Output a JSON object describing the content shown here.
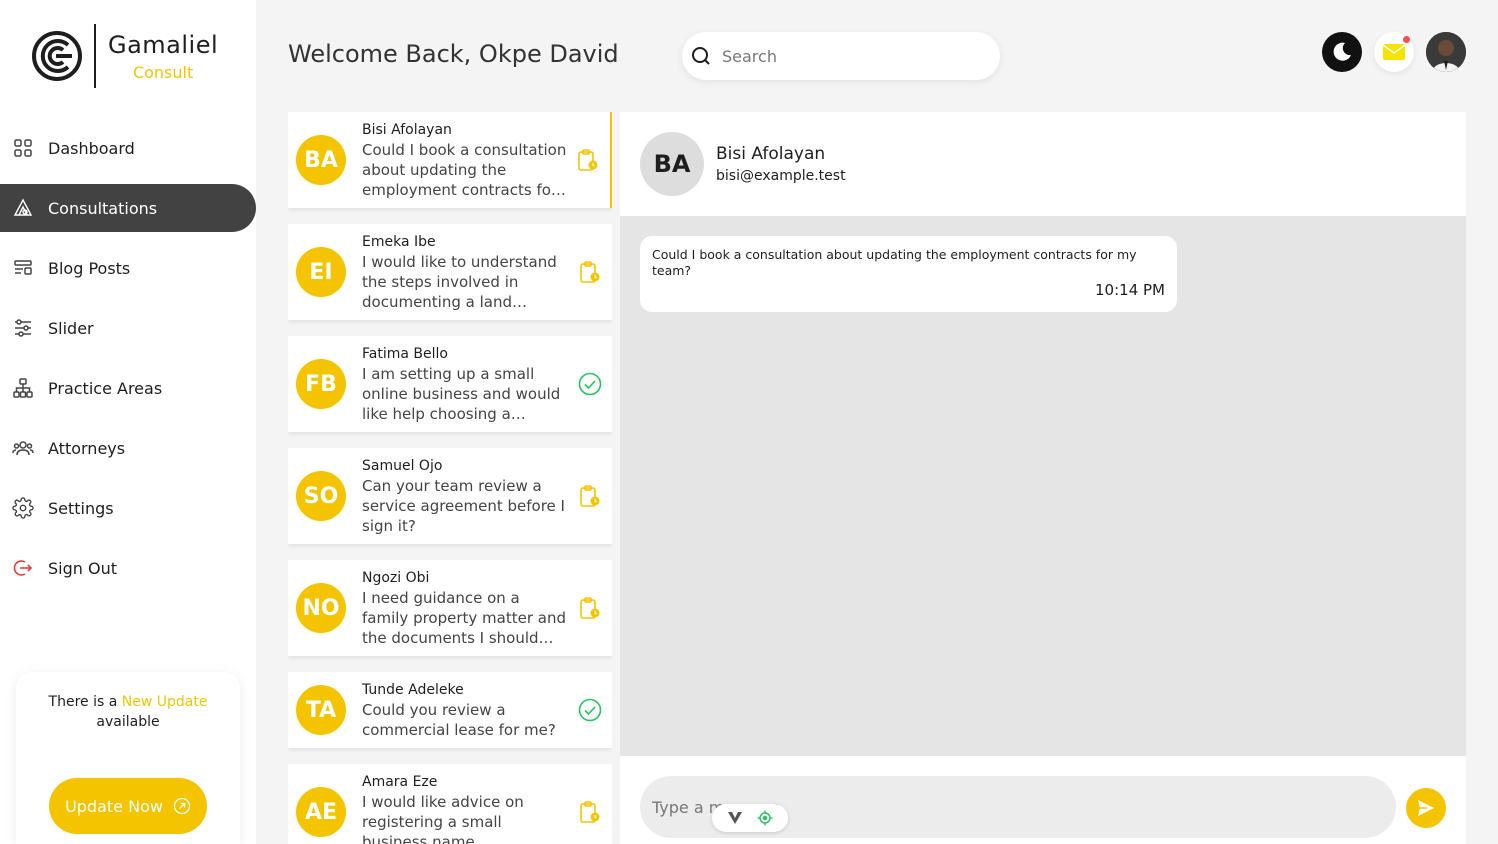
{
  "brand": {
    "name": "Gamaliel",
    "subtitle": "Consult"
  },
  "nav": {
    "items": [
      {
        "label": "Dashboard",
        "icon": "grid-icon",
        "active": false
      },
      {
        "label": "Consultations",
        "icon": "consultation-icon",
        "active": true
      },
      {
        "label": "Blog Posts",
        "icon": "blog-icon",
        "active": false
      },
      {
        "label": "Slider",
        "icon": "sliders-icon",
        "active": false
      },
      {
        "label": "Practice Areas",
        "icon": "hierarchy-icon",
        "active": false
      },
      {
        "label": "Attorneys",
        "icon": "users-icon",
        "active": false
      },
      {
        "label": "Settings",
        "icon": "gear-icon",
        "active": false
      },
      {
        "label": "Sign Out",
        "icon": "sign-out-icon",
        "active": false
      }
    ]
  },
  "update": {
    "prefix": "There is a",
    "highlight": "New Update",
    "suffix": "available",
    "button_label": "Update Now"
  },
  "header": {
    "welcome": "Welcome Back, Okpe David",
    "search_placeholder": "Search"
  },
  "conversations": [
    {
      "initials": "BA",
      "name": "Bisi Afolayan",
      "message": "Could I book a consultation about updating the employment contracts for my team?",
      "status": "pending"
    },
    {
      "initials": "EI",
      "name": "Emeka Ibe",
      "message": "I would like to understand the steps involved in documenting a land purchase.",
      "status": "pending"
    },
    {
      "initials": "FB",
      "name": "Fatima Bello",
      "message": "I am setting up a small online business and would like help choosing a structure.",
      "status": "done"
    },
    {
      "initials": "SO",
      "name": "Samuel Ojo",
      "message": "Can your team review a service agreement before I sign it?",
      "status": "pending"
    },
    {
      "initials": "NO",
      "name": "Ngozi Obi",
      "message": "I need guidance on a family property matter and the documents I should prepare.",
      "status": "pending"
    },
    {
      "initials": "TA",
      "name": "Tunde Adeleke",
      "message": "Could you review a commercial lease for me?",
      "status": "done"
    },
    {
      "initials": "AE",
      "name": "Amara Eze",
      "message": "I would like advice on registering a small business name.",
      "status": "pending"
    }
  ],
  "chat": {
    "initials": "BA",
    "name": "Bisi Afolayan",
    "email": "bisi@example.test",
    "messages": [
      {
        "text": "Could I book a consultation about updating the employment contracts for my team?",
        "time": "10:14 PM"
      }
    ],
    "input_placeholder": "Type a message"
  },
  "colors": {
    "accent": "#f5c400",
    "active_nav": "#424242",
    "done": "#22c55e",
    "notification_dot": "#ff4d4d"
  }
}
